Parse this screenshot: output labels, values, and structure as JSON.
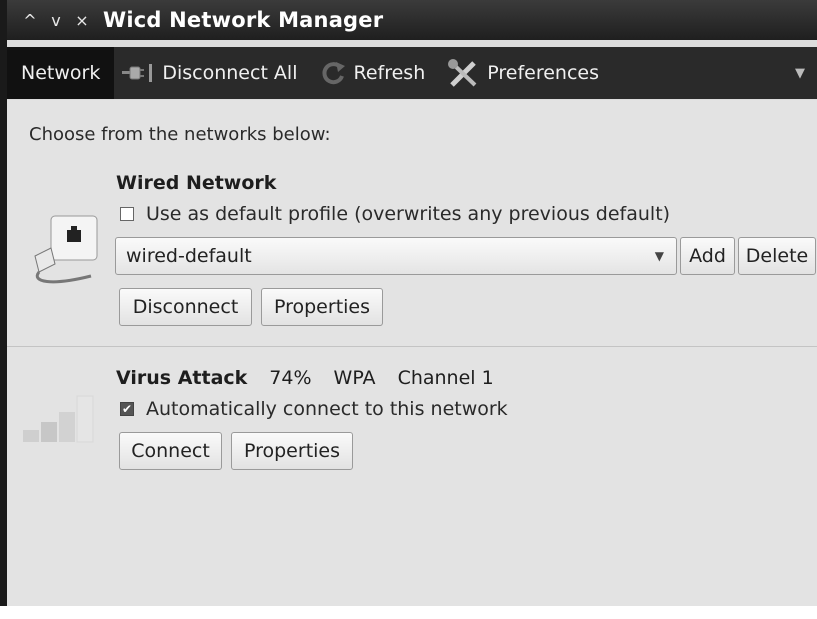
{
  "window": {
    "title": "Wicd Network Manager",
    "controls": {
      "up": "^",
      "down": "v",
      "close": "×"
    }
  },
  "toolbar": {
    "network_label": "Network",
    "disconnect_all_label": "Disconnect All",
    "refresh_label": "Refresh",
    "preferences_label": "Preferences",
    "more_glyph": "▼"
  },
  "content": {
    "intro": "Choose from the networks below:",
    "wired": {
      "title": "Wired Network",
      "default_profile_label": "Use as default profile (overwrites any previous default)",
      "default_profile_checked": false,
      "profile_value": "wired-default",
      "add_label": "Add",
      "delete_label": "Delete",
      "disconnect_label": "Disconnect",
      "properties_label": "Properties"
    },
    "wireless": {
      "name": "Virus Attack",
      "strength": "74%",
      "security": "WPA",
      "channel": "Channel 1",
      "autoconnect_label": "Automatically connect to this network",
      "autoconnect_checked": true,
      "connect_label": "Connect",
      "properties_label": "Properties"
    }
  },
  "icons": {
    "disconnect": "plug-icon",
    "refresh": "refresh-icon",
    "preferences": "tools-icon",
    "wired": "wired-network-icon",
    "wireless": "signal-strength-icon"
  },
  "colors": {
    "titlebar": "#2a2a2a",
    "toolbar": "#2a2a2a",
    "content_bg": "#e3e3e3"
  }
}
